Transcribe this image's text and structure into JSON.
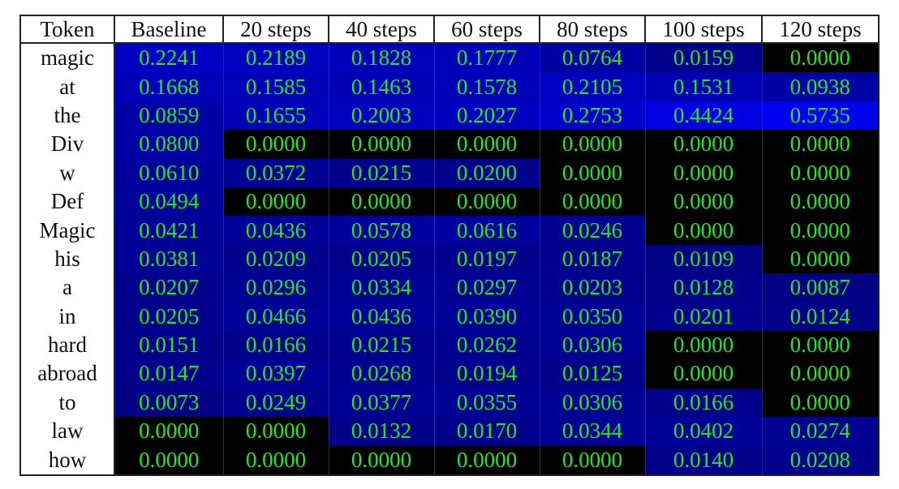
{
  "chart_data": {
    "type": "heatmap",
    "title": "",
    "row_header": "Token",
    "columns": [
      "Baseline",
      "20 steps",
      "40 steps",
      "60 steps",
      "80 steps",
      "100 steps",
      "120 steps"
    ],
    "rows": [
      {
        "token": "magic",
        "values": [
          "0.2241",
          "0.2189",
          "0.1828",
          "0.1777",
          "0.0764",
          "0.0159",
          "0.0000"
        ]
      },
      {
        "token": "at",
        "values": [
          "0.1668",
          "0.1585",
          "0.1463",
          "0.1578",
          "0.2105",
          "0.1531",
          "0.0938"
        ]
      },
      {
        "token": "the",
        "values": [
          "0.0859",
          "0.1655",
          "0.2003",
          "0.2027",
          "0.2753",
          "0.4424",
          "0.5735"
        ]
      },
      {
        "token": "Div",
        "values": [
          "0.0800",
          "0.0000",
          "0.0000",
          "0.0000",
          "0.0000",
          "0.0000",
          "0.0000"
        ]
      },
      {
        "token": "w",
        "values": [
          "0.0610",
          "0.0372",
          "0.0215",
          "0.0200",
          "0.0000",
          "0.0000",
          "0.0000"
        ]
      },
      {
        "token": "Def",
        "values": [
          "0.0494",
          "0.0000",
          "0.0000",
          "0.0000",
          "0.0000",
          "0.0000",
          "0.0000"
        ]
      },
      {
        "token": "Magic",
        "values": [
          "0.0421",
          "0.0436",
          "0.0578",
          "0.0616",
          "0.0246",
          "0.0000",
          "0.0000"
        ]
      },
      {
        "token": "his",
        "values": [
          "0.0381",
          "0.0209",
          "0.0205",
          "0.0197",
          "0.0187",
          "0.0109",
          "0.0000"
        ]
      },
      {
        "token": "a",
        "values": [
          "0.0207",
          "0.0296",
          "0.0334",
          "0.0297",
          "0.0203",
          "0.0128",
          "0.0087"
        ]
      },
      {
        "token": "in",
        "values": [
          "0.0205",
          "0.0466",
          "0.0436",
          "0.0390",
          "0.0350",
          "0.0201",
          "0.0124"
        ]
      },
      {
        "token": "hard",
        "values": [
          "0.0151",
          "0.0166",
          "0.0215",
          "0.0262",
          "0.0306",
          "0.0000",
          "0.0000"
        ]
      },
      {
        "token": "abroad",
        "values": [
          "0.0147",
          "0.0397",
          "0.0268",
          "0.0194",
          "0.0125",
          "0.0000",
          "0.0000"
        ]
      },
      {
        "token": "to",
        "values": [
          "0.0073",
          "0.0249",
          "0.0377",
          "0.0355",
          "0.0306",
          "0.0166",
          "0.0000"
        ]
      },
      {
        "token": "law",
        "values": [
          "0.0000",
          "0.0000",
          "0.0132",
          "0.0170",
          "0.0344",
          "0.0402",
          "0.0274"
        ]
      },
      {
        "token": "how",
        "values": [
          "0.0000",
          "0.0000",
          "0.0000",
          "0.0000",
          "0.0000",
          "0.0140",
          "0.0208"
        ]
      }
    ],
    "colormap": {
      "zero": "#000000",
      "low": "#00007a",
      "high": "#0000f0",
      "text": "#22e822"
    },
    "value_range": [
      0,
      0.5735
    ]
  }
}
